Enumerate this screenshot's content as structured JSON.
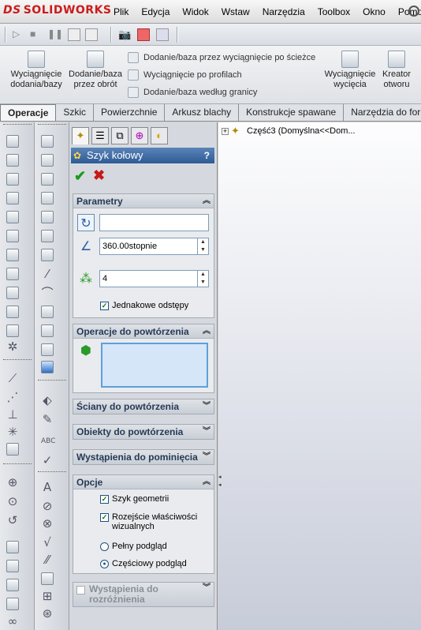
{
  "app": {
    "logo_text": "SOLIDWORKS",
    "logo_prefix": "DS"
  },
  "menu": [
    "Plik",
    "Edycja",
    "Widok",
    "Wstaw",
    "Narzędzia",
    "Toolbox",
    "Okno",
    "Pomoc"
  ],
  "ribbon": {
    "extrude_boss": "Wyciągnięcie\ndodania/bazy",
    "revolve_boss": "Dodanie/baza\nprzez obrót",
    "sweep_boss": "Dodanie/baza przez wyciągnięcie po ścieżce",
    "loft_cut": "Wyciągnięcie po profilach",
    "boundary_boss": "Dodanie/baza według granicy",
    "extrude_cut": "Wyciągnięcie\nwycięcia",
    "hole_wizard": "Kreator\notworu"
  },
  "tabs": [
    {
      "label": "Operacje",
      "active": true
    },
    {
      "label": "Szkic",
      "active": false
    },
    {
      "label": "Powierzchnie",
      "active": false
    },
    {
      "label": "Arkusz blachy",
      "active": false
    },
    {
      "label": "Konstrukcje spawane",
      "active": false
    },
    {
      "label": "Narzędzia do for",
      "active": false
    }
  ],
  "property_manager": {
    "title": "Szyk kołowy",
    "help": "?",
    "groups": {
      "parametry": {
        "label": "Parametry",
        "axis_value": "",
        "angle_value": "360.00stopnie",
        "instances_value": "4",
        "equal_spacing_label": "Jednakowe odstępy",
        "equal_spacing_checked": true
      },
      "features": {
        "label": "Operacje do powtórzenia"
      },
      "faces": {
        "label": "Ściany do powtórzenia"
      },
      "bodies": {
        "label": "Obiekty do powtórzenia"
      },
      "skip": {
        "label": "Wystąpienia do pominięcia"
      },
      "options": {
        "label": "Opcje",
        "geometry_pattern": "Szyk geometrii",
        "geometry_pattern_checked": true,
        "propagate_visual": "Rozejście właściwości wizualnych",
        "propagate_visual_checked": true,
        "full_preview": "Pełny podgląd",
        "partial_preview": "Częściowy podgląd",
        "selected_preview": "partial"
      },
      "vary": {
        "label": "Wystąpienia do rozróżnienia"
      }
    }
  },
  "feature_tree": {
    "root_label": "Część3  (Domyślna<<Dom..."
  },
  "colors": {
    "accent": "#2e5b95",
    "logo_red": "#cc1b1b",
    "ok_green": "#1a9a1a",
    "cancel_red": "#c81818"
  }
}
